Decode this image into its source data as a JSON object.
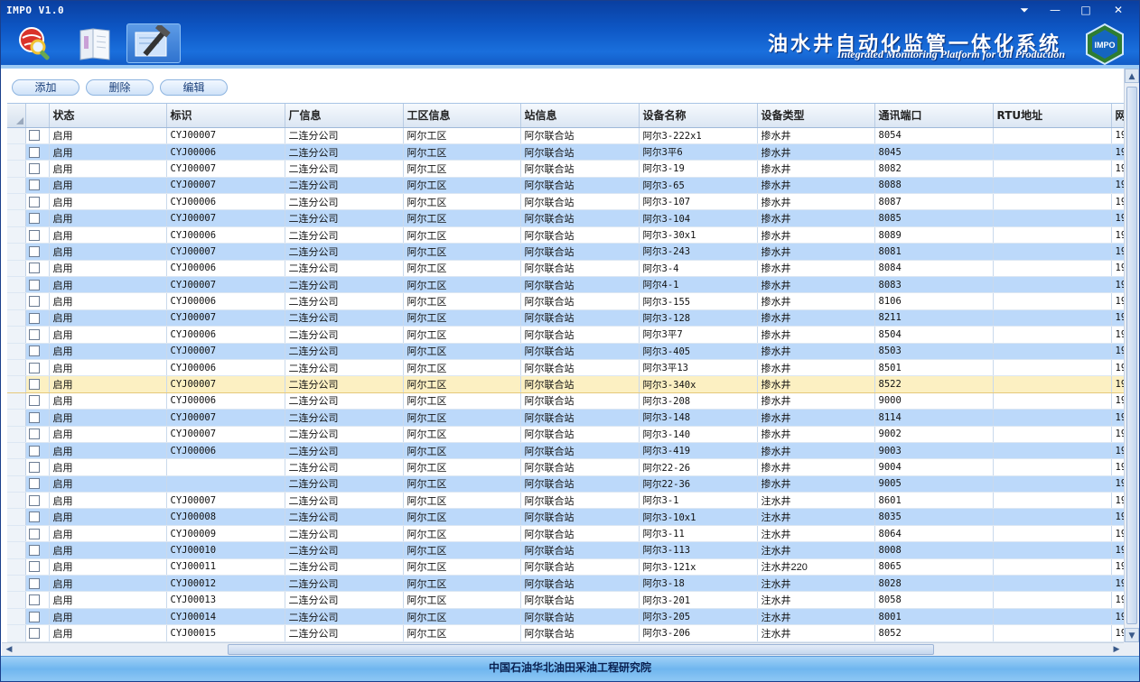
{
  "window": {
    "title": "IMPO V1.0"
  },
  "brand": {
    "title_cn": "油水井自动化监管一体化系统",
    "title_en": "Integrated Monitoring Platform for Oil Production",
    "logo_text": "IMPO"
  },
  "toolbar": {
    "add_label": "添加",
    "delete_label": "删除",
    "edit_label": "编辑"
  },
  "table": {
    "columns": [
      "状态",
      "标识",
      "厂信息",
      "工区信息",
      "站信息",
      "设备名称",
      "设备类型",
      "通讯端口",
      "RTU地址",
      "网"
    ],
    "selected_row_index": 15,
    "rows": [
      [
        "启用",
        "CYJ00007",
        "二连分公司",
        "阿尔工区",
        "阿尔联合站",
        "阿尔3-222x1",
        "掺水井",
        "8054",
        "",
        "19"
      ],
      [
        "启用",
        "CYJ00006",
        "二连分公司",
        "阿尔工区",
        "阿尔联合站",
        "阿尔3平6",
        "掺水井",
        "8045",
        "",
        "19"
      ],
      [
        "启用",
        "CYJ00007",
        "二连分公司",
        "阿尔工区",
        "阿尔联合站",
        "阿尔3-19",
        "掺水井",
        "8082",
        "",
        "19"
      ],
      [
        "启用",
        "CYJ00007",
        "二连分公司",
        "阿尔工区",
        "阿尔联合站",
        "阿尔3-65",
        "掺水井",
        "8088",
        "",
        "19"
      ],
      [
        "启用",
        "CYJ00006",
        "二连分公司",
        "阿尔工区",
        "阿尔联合站",
        "阿尔3-107",
        "掺水井",
        "8087",
        "",
        "19"
      ],
      [
        "启用",
        "CYJ00007",
        "二连分公司",
        "阿尔工区",
        "阿尔联合站",
        "阿尔3-104",
        "掺水井",
        "8085",
        "",
        "19"
      ],
      [
        "启用",
        "CYJ00006",
        "二连分公司",
        "阿尔工区",
        "阿尔联合站",
        "阿尔3-30x1",
        "掺水井",
        "8089",
        "",
        "19"
      ],
      [
        "启用",
        "CYJ00007",
        "二连分公司",
        "阿尔工区",
        "阿尔联合站",
        "阿尔3-243",
        "掺水井",
        "8081",
        "",
        "19"
      ],
      [
        "启用",
        "CYJ00006",
        "二连分公司",
        "阿尔工区",
        "阿尔联合站",
        "阿尔3-4",
        "掺水井",
        "8084",
        "",
        "19"
      ],
      [
        "启用",
        "CYJ00007",
        "二连分公司",
        "阿尔工区",
        "阿尔联合站",
        "阿尔4-1",
        "掺水井",
        "8083",
        "",
        "19"
      ],
      [
        "启用",
        "CYJ00006",
        "二连分公司",
        "阿尔工区",
        "阿尔联合站",
        "阿尔3-155",
        "掺水井",
        "8106",
        "",
        "19"
      ],
      [
        "启用",
        "CYJ00007",
        "二连分公司",
        "阿尔工区",
        "阿尔联合站",
        "阿尔3-128",
        "掺水井",
        "8211",
        "",
        "19"
      ],
      [
        "启用",
        "CYJ00006",
        "二连分公司",
        "阿尔工区",
        "阿尔联合站",
        "阿尔3平7",
        "掺水井",
        "8504",
        "",
        "19"
      ],
      [
        "启用",
        "CYJ00007",
        "二连分公司",
        "阿尔工区",
        "阿尔联合站",
        "阿尔3-405",
        "掺水井",
        "8503",
        "",
        "19"
      ],
      [
        "启用",
        "CYJ00006",
        "二连分公司",
        "阿尔工区",
        "阿尔联合站",
        "阿尔3平13",
        "掺水井",
        "8501",
        "",
        "19"
      ],
      [
        "启用",
        "CYJ00007",
        "二连分公司",
        "阿尔工区",
        "阿尔联合站",
        "阿尔3-340x",
        "掺水井",
        "8522",
        "",
        "19"
      ],
      [
        "启用",
        "CYJ00006",
        "二连分公司",
        "阿尔工区",
        "阿尔联合站",
        "阿尔3-208",
        "掺水井",
        "9000",
        "",
        "19"
      ],
      [
        "启用",
        "CYJ00007",
        "二连分公司",
        "阿尔工区",
        "阿尔联合站",
        "阿尔3-148",
        "掺水井",
        "8114",
        "",
        "19"
      ],
      [
        "启用",
        "CYJ00007",
        "二连分公司",
        "阿尔工区",
        "阿尔联合站",
        "阿尔3-140",
        "掺水井",
        "9002",
        "",
        "19"
      ],
      [
        "启用",
        "CYJ00006",
        "二连分公司",
        "阿尔工区",
        "阿尔联合站",
        "阿尔3-419",
        "掺水井",
        "9003",
        "",
        "19"
      ],
      [
        "启用",
        "",
        "二连分公司",
        "阿尔工区",
        "阿尔联合站",
        "阿尔22-26",
        "掺水井",
        "9004",
        "",
        "19"
      ],
      [
        "启用",
        "",
        "二连分公司",
        "阿尔工区",
        "阿尔联合站",
        "阿尔22-36",
        "掺水井",
        "9005",
        "",
        "19"
      ],
      [
        "启用",
        "CYJ00007",
        "二连分公司",
        "阿尔工区",
        "阿尔联合站",
        "阿尔3-1",
        "注水井",
        "8601",
        "",
        "19"
      ],
      [
        "启用",
        "CYJ00008",
        "二连分公司",
        "阿尔工区",
        "阿尔联合站",
        "阿尔3-10x1",
        "注水井",
        "8035",
        "",
        "19"
      ],
      [
        "启用",
        "CYJ00009",
        "二连分公司",
        "阿尔工区",
        "阿尔联合站",
        "阿尔3-11",
        "注水井",
        "8064",
        "",
        "19"
      ],
      [
        "启用",
        "CYJ00010",
        "二连分公司",
        "阿尔工区",
        "阿尔联合站",
        "阿尔3-113",
        "注水井",
        "8008",
        "",
        "19"
      ],
      [
        "启用",
        "CYJ00011",
        "二连分公司",
        "阿尔工区",
        "阿尔联合站",
        "阿尔3-121x",
        "注水井220",
        "8065",
        "",
        "19"
      ],
      [
        "启用",
        "CYJ00012",
        "二连分公司",
        "阿尔工区",
        "阿尔联合站",
        "阿尔3-18",
        "注水井",
        "8028",
        "",
        "19"
      ],
      [
        "启用",
        "CYJ00013",
        "二连分公司",
        "阿尔工区",
        "阿尔联合站",
        "阿尔3-201",
        "注水井",
        "8058",
        "",
        "19"
      ],
      [
        "启用",
        "CYJ00014",
        "二连分公司",
        "阿尔工区",
        "阿尔联合站",
        "阿尔3-205",
        "注水井",
        "8001",
        "",
        "19"
      ],
      [
        "启用",
        "CYJ00015",
        "二连分公司",
        "阿尔工区",
        "阿尔联合站",
        "阿尔3-206",
        "注水井",
        "8052",
        "",
        "19"
      ]
    ]
  },
  "footer": {
    "text": "中国石油华北油田采油工程研究院"
  },
  "icons": {
    "minimize": "minimize-icon",
    "maximize": "maximize-icon",
    "close": "close-icon",
    "pin": "pin-icon",
    "nav_1": "globe-search-icon",
    "nav_2": "book-icon",
    "nav_3": "tools-icon"
  },
  "colors": {
    "header": "#0d56c4",
    "row_alt": "#bcd9fa",
    "row_selected": "#fcf0c2",
    "footer": "#8ec7f4"
  }
}
